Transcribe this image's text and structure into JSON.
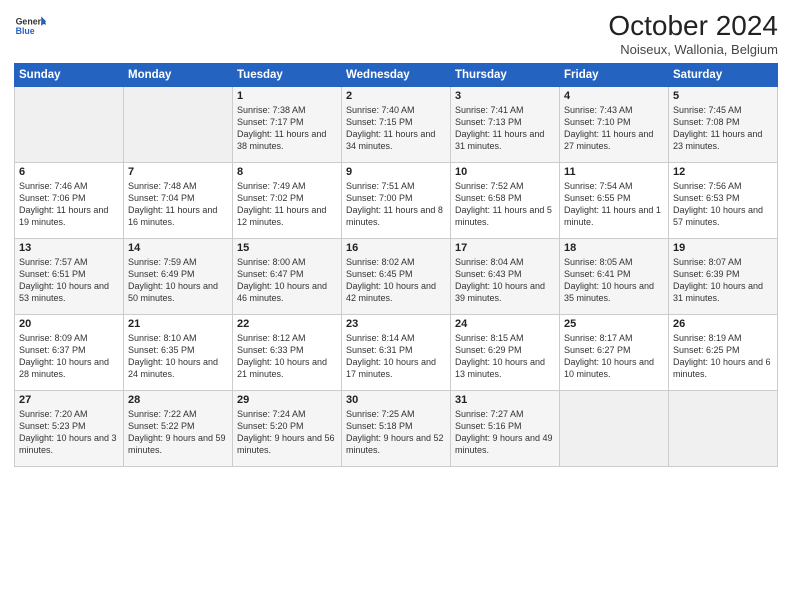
{
  "header": {
    "logo_line1": "General",
    "logo_line2": "Blue",
    "month": "October 2024",
    "location": "Noiseux, Wallonia, Belgium"
  },
  "weekdays": [
    "Sunday",
    "Monday",
    "Tuesday",
    "Wednesday",
    "Thursday",
    "Friday",
    "Saturday"
  ],
  "weeks": [
    [
      {
        "day": "",
        "empty": true
      },
      {
        "day": "",
        "empty": true
      },
      {
        "day": "1",
        "sunrise": "7:38 AM",
        "sunset": "7:17 PM",
        "daylight": "11 hours and 38 minutes."
      },
      {
        "day": "2",
        "sunrise": "7:40 AM",
        "sunset": "7:15 PM",
        "daylight": "11 hours and 34 minutes."
      },
      {
        "day": "3",
        "sunrise": "7:41 AM",
        "sunset": "7:13 PM",
        "daylight": "11 hours and 31 minutes."
      },
      {
        "day": "4",
        "sunrise": "7:43 AM",
        "sunset": "7:10 PM",
        "daylight": "11 hours and 27 minutes."
      },
      {
        "day": "5",
        "sunrise": "7:45 AM",
        "sunset": "7:08 PM",
        "daylight": "11 hours and 23 minutes."
      }
    ],
    [
      {
        "day": "6",
        "sunrise": "7:46 AM",
        "sunset": "7:06 PM",
        "daylight": "11 hours and 19 minutes."
      },
      {
        "day": "7",
        "sunrise": "7:48 AM",
        "sunset": "7:04 PM",
        "daylight": "11 hours and 16 minutes."
      },
      {
        "day": "8",
        "sunrise": "7:49 AM",
        "sunset": "7:02 PM",
        "daylight": "11 hours and 12 minutes."
      },
      {
        "day": "9",
        "sunrise": "7:51 AM",
        "sunset": "7:00 PM",
        "daylight": "11 hours and 8 minutes."
      },
      {
        "day": "10",
        "sunrise": "7:52 AM",
        "sunset": "6:58 PM",
        "daylight": "11 hours and 5 minutes."
      },
      {
        "day": "11",
        "sunrise": "7:54 AM",
        "sunset": "6:55 PM",
        "daylight": "11 hours and 1 minute."
      },
      {
        "day": "12",
        "sunrise": "7:56 AM",
        "sunset": "6:53 PM",
        "daylight": "10 hours and 57 minutes."
      }
    ],
    [
      {
        "day": "13",
        "sunrise": "7:57 AM",
        "sunset": "6:51 PM",
        "daylight": "10 hours and 53 minutes."
      },
      {
        "day": "14",
        "sunrise": "7:59 AM",
        "sunset": "6:49 PM",
        "daylight": "10 hours and 50 minutes."
      },
      {
        "day": "15",
        "sunrise": "8:00 AM",
        "sunset": "6:47 PM",
        "daylight": "10 hours and 46 minutes."
      },
      {
        "day": "16",
        "sunrise": "8:02 AM",
        "sunset": "6:45 PM",
        "daylight": "10 hours and 42 minutes."
      },
      {
        "day": "17",
        "sunrise": "8:04 AM",
        "sunset": "6:43 PM",
        "daylight": "10 hours and 39 minutes."
      },
      {
        "day": "18",
        "sunrise": "8:05 AM",
        "sunset": "6:41 PM",
        "daylight": "10 hours and 35 minutes."
      },
      {
        "day": "19",
        "sunrise": "8:07 AM",
        "sunset": "6:39 PM",
        "daylight": "10 hours and 31 minutes."
      }
    ],
    [
      {
        "day": "20",
        "sunrise": "8:09 AM",
        "sunset": "6:37 PM",
        "daylight": "10 hours and 28 minutes."
      },
      {
        "day": "21",
        "sunrise": "8:10 AM",
        "sunset": "6:35 PM",
        "daylight": "10 hours and 24 minutes."
      },
      {
        "day": "22",
        "sunrise": "8:12 AM",
        "sunset": "6:33 PM",
        "daylight": "10 hours and 21 minutes."
      },
      {
        "day": "23",
        "sunrise": "8:14 AM",
        "sunset": "6:31 PM",
        "daylight": "10 hours and 17 minutes."
      },
      {
        "day": "24",
        "sunrise": "8:15 AM",
        "sunset": "6:29 PM",
        "daylight": "10 hours and 13 minutes."
      },
      {
        "day": "25",
        "sunrise": "8:17 AM",
        "sunset": "6:27 PM",
        "daylight": "10 hours and 10 minutes."
      },
      {
        "day": "26",
        "sunrise": "8:19 AM",
        "sunset": "6:25 PM",
        "daylight": "10 hours and 6 minutes."
      }
    ],
    [
      {
        "day": "27",
        "sunrise": "7:20 AM",
        "sunset": "5:23 PM",
        "daylight": "10 hours and 3 minutes."
      },
      {
        "day": "28",
        "sunrise": "7:22 AM",
        "sunset": "5:22 PM",
        "daylight": "9 hours and 59 minutes."
      },
      {
        "day": "29",
        "sunrise": "7:24 AM",
        "sunset": "5:20 PM",
        "daylight": "9 hours and 56 minutes."
      },
      {
        "day": "30",
        "sunrise": "7:25 AM",
        "sunset": "5:18 PM",
        "daylight": "9 hours and 52 minutes."
      },
      {
        "day": "31",
        "sunrise": "7:27 AM",
        "sunset": "5:16 PM",
        "daylight": "9 hours and 49 minutes."
      },
      {
        "day": "",
        "empty": true
      },
      {
        "day": "",
        "empty": true
      }
    ]
  ],
  "labels": {
    "sunrise_prefix": "Sunrise: ",
    "sunset_prefix": "Sunset: ",
    "daylight_prefix": "Daylight: "
  }
}
